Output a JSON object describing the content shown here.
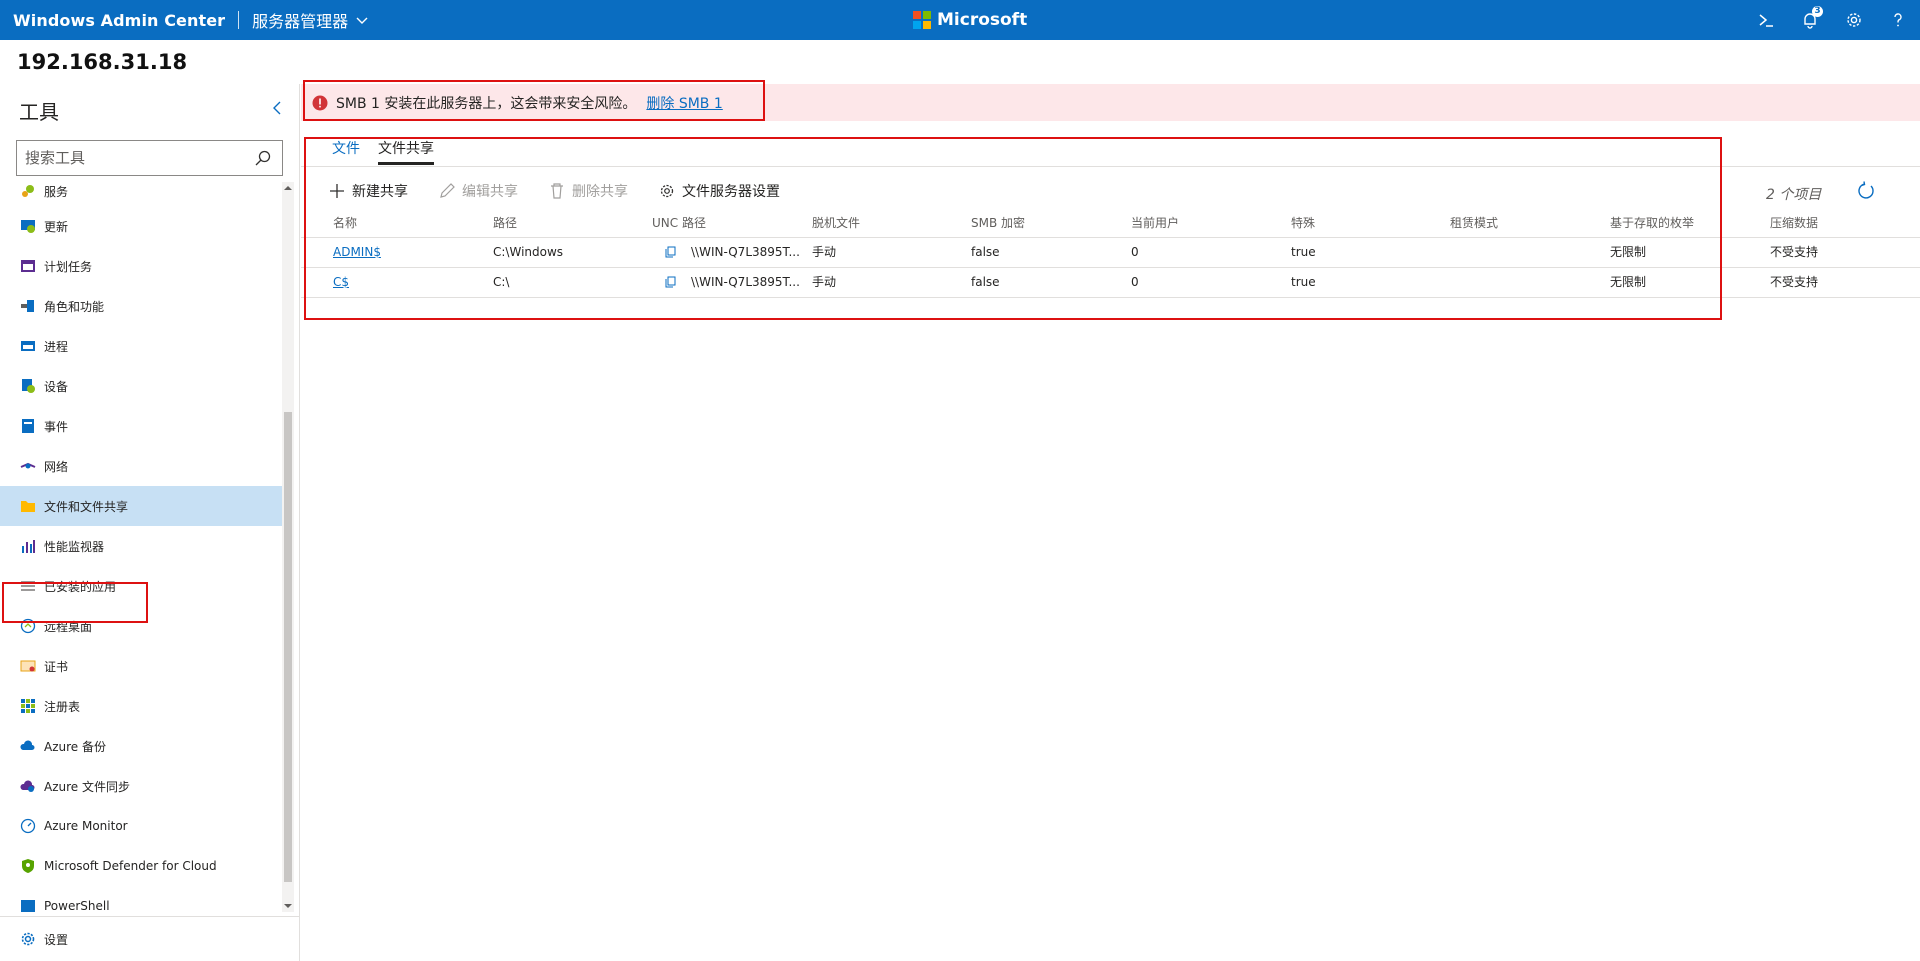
{
  "app": {
    "title": "Windows Admin Center",
    "breadcrumb": "服务器管理器",
    "vendor": "Microsoft",
    "notification_count": "3"
  },
  "server": {
    "name": "192.168.31.18"
  },
  "sidebar": {
    "title": "工具",
    "search_placeholder": "搜索工具",
    "items": [
      {
        "label": "服务",
        "icon": "services-icon"
      },
      {
        "label": "更新",
        "icon": "updates-icon"
      },
      {
        "label": "计划任务",
        "icon": "scheduled-tasks-icon"
      },
      {
        "label": "角色和功能",
        "icon": "roles-features-icon"
      },
      {
        "label": "进程",
        "icon": "processes-icon"
      },
      {
        "label": "设备",
        "icon": "devices-icon"
      },
      {
        "label": "事件",
        "icon": "events-icon"
      },
      {
        "label": "网络",
        "icon": "network-icon"
      },
      {
        "label": "文件和文件共享",
        "icon": "folder-icon"
      },
      {
        "label": "性能监视器",
        "icon": "performance-monitor-icon"
      },
      {
        "label": "已安装的应用",
        "icon": "installed-apps-icon"
      },
      {
        "label": "远程桌面",
        "icon": "remote-desktop-icon"
      },
      {
        "label": "证书",
        "icon": "certificate-icon"
      },
      {
        "label": "注册表",
        "icon": "registry-icon"
      },
      {
        "label": "Azure 备份",
        "icon": "azure-backup-icon"
      },
      {
        "label": "Azure 文件同步",
        "icon": "azure-file-sync-icon"
      },
      {
        "label": "Azure Monitor",
        "icon": "azure-monitor-icon"
      },
      {
        "label": "Microsoft Defender for Cloud",
        "icon": "defender-icon"
      },
      {
        "label": "PowerShell",
        "icon": "powershell-icon"
      }
    ],
    "footer_label": "设置"
  },
  "alert": {
    "message": "SMB 1 安装在此服务器上，这会带来安全风险。",
    "link": "删除 SMB 1"
  },
  "tabs": {
    "files": "文件",
    "shares": "文件共享"
  },
  "toolbar": {
    "new_share": "新建共享",
    "edit_share": "编辑共享",
    "delete_share": "删除共享",
    "server_settings": "文件服务器设置",
    "items_count": "2 个项目"
  },
  "table": {
    "columns": [
      "名称",
      "路径",
      "UNC 路径",
      "脱机文件",
      "SMB 加密",
      "当前用户",
      "特殊",
      "租赁模式",
      "基于存取的枚举",
      "压缩数据"
    ],
    "rows": [
      [
        "ADMIN$",
        "C:\\Windows",
        "\\\\WIN-Q7L3895T...",
        "手动",
        "false",
        "0",
        "true",
        "",
        "无限制",
        "不受支持"
      ],
      [
        "C$",
        "C:\\",
        "\\\\WIN-Q7L3895T...",
        "手动",
        "false",
        "0",
        "true",
        "",
        "无限制",
        "不受支持"
      ]
    ]
  },
  "colors": {
    "accent": "#0a6dc1",
    "alert_bg": "#fde7e9",
    "active_bg": "#c7e0f4",
    "highlight": "#dd1111"
  }
}
